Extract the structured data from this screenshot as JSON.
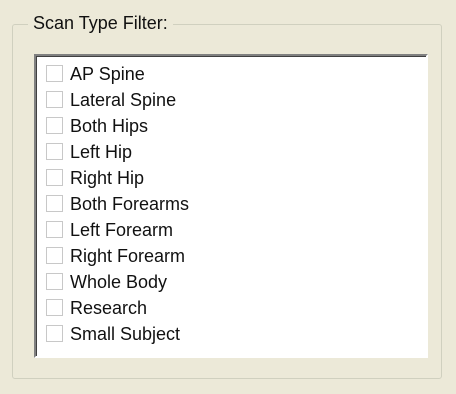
{
  "groupbox": {
    "title": "Scan Type Filter:"
  },
  "scan_types": [
    {
      "label": "AP Spine",
      "checked": false
    },
    {
      "label": "Lateral Spine",
      "checked": false
    },
    {
      "label": "Both Hips",
      "checked": false
    },
    {
      "label": "Left Hip",
      "checked": false
    },
    {
      "label": "Right Hip",
      "checked": false
    },
    {
      "label": "Both Forearms",
      "checked": false
    },
    {
      "label": "Left Forearm",
      "checked": false
    },
    {
      "label": "Right Forearm",
      "checked": false
    },
    {
      "label": "Whole Body",
      "checked": false
    },
    {
      "label": "Research",
      "checked": false
    },
    {
      "label": "Small Subject",
      "checked": false
    }
  ]
}
